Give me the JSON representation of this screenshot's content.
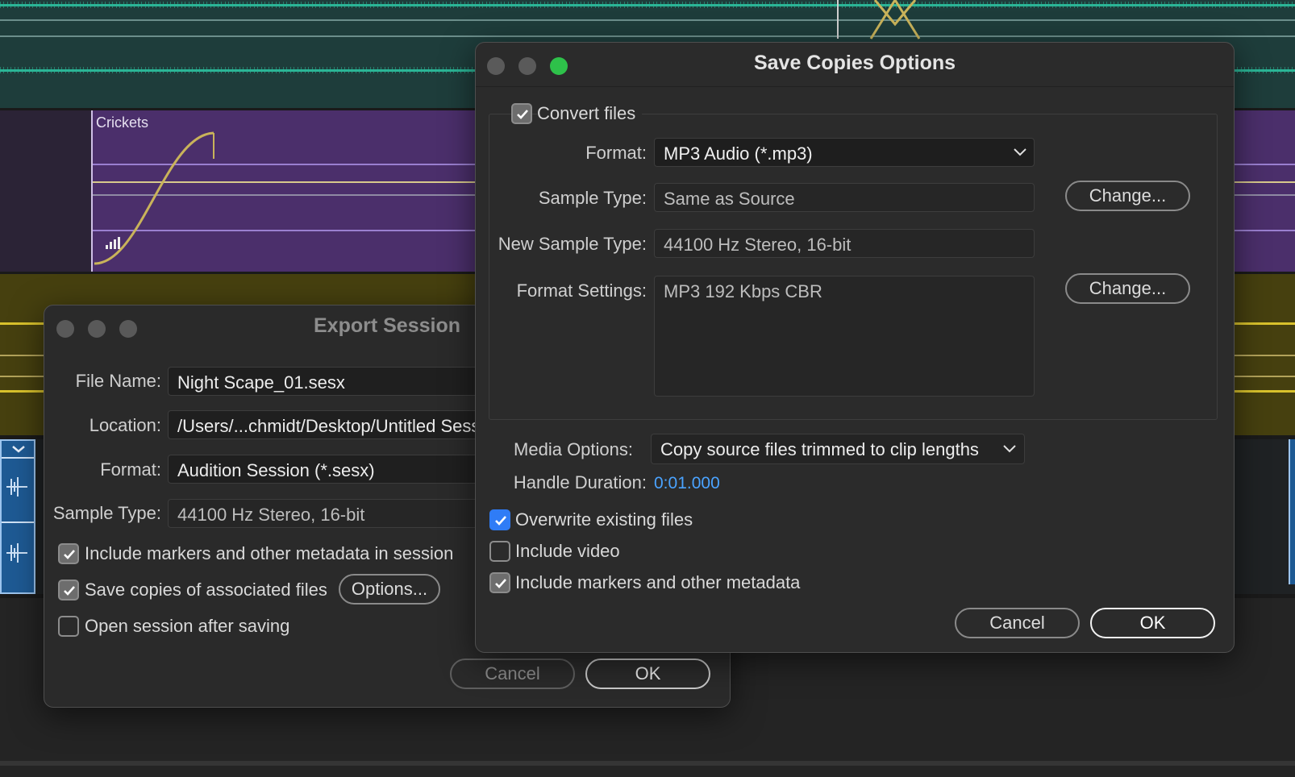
{
  "background": {
    "clip_name": "Crickets"
  },
  "export_session": {
    "title": "Export Session",
    "file_name_label": "File Name:",
    "file_name_value": "Night Scape_01.sesx",
    "location_label": "Location:",
    "location_value": "/Users/...chmidt/Desktop/Untitled Sess",
    "format_label": "Format:",
    "format_value": "Audition Session (*.sesx)",
    "sample_type_label": "Sample Type:",
    "sample_type_value": "44100 Hz Stereo, 16-bit",
    "include_markers_label": "Include markers and other metadata in session",
    "include_markers_checked": true,
    "save_copies_label": "Save copies of associated files",
    "save_copies_checked": true,
    "options_button": "Options...",
    "open_after_label": "Open session after saving",
    "open_after_checked": false,
    "cancel_button": "Cancel",
    "ok_button": "OK"
  },
  "save_copies": {
    "title": "Save Copies Options",
    "convert_files_label": "Convert files",
    "convert_files_checked": true,
    "format_label": "Format:",
    "format_value": "MP3 Audio (*.mp3)",
    "sample_type_label": "Sample Type:",
    "sample_type_value": "Same as Source",
    "change_button_1": "Change...",
    "new_sample_type_label": "New Sample Type:",
    "new_sample_type_value": "44100 Hz Stereo, 16-bit",
    "format_settings_label": "Format Settings:",
    "format_settings_value": "MP3 192 Kbps CBR",
    "change_button_2": "Change...",
    "media_options_label": "Media Options:",
    "media_options_value": "Copy source files trimmed to clip lengths",
    "handle_duration_label": "Handle Duration:",
    "handle_duration_value": "0:01.000",
    "overwrite_label": "Overwrite existing files",
    "overwrite_checked": true,
    "include_video_label": "Include video",
    "include_video_checked": false,
    "include_markers_label": "Include markers and other metadata",
    "include_markers_checked": true,
    "cancel_button": "Cancel",
    "ok_button": "OK"
  },
  "colors": {
    "accent_blue": "#2f7cf6",
    "link_blue": "#4aa3ff",
    "traffic_green": "#2ec14a"
  }
}
